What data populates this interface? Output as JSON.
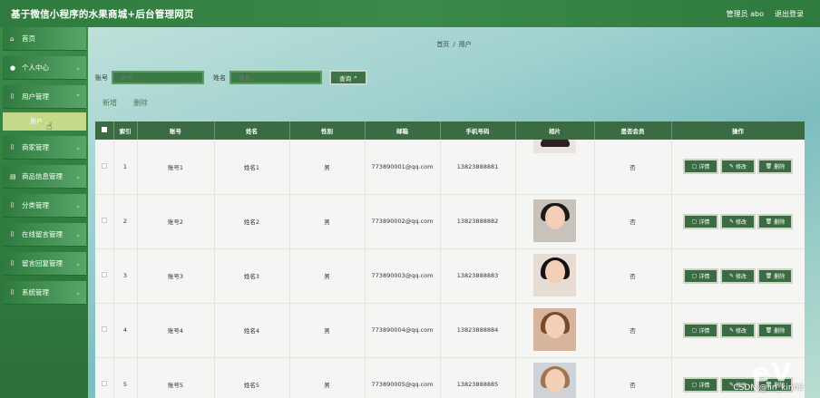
{
  "header": {
    "app_title": "基于微信小程序的水果商城+后台管理网页",
    "admin_label": "管理员 abo",
    "logout_label": "退出登录"
  },
  "sidebar": {
    "items": [
      {
        "label": "首页",
        "icon": "home-icon",
        "chevron": false
      },
      {
        "label": "个人中心",
        "icon": "user-icon",
        "chevron": true
      },
      {
        "label": "用户管理",
        "icon": "grid-icon",
        "chevron": true
      },
      {
        "label": "商家管理",
        "icon": "grid-icon",
        "chevron": true
      },
      {
        "label": "商品信息管理",
        "icon": "list-icon",
        "chevron": true
      },
      {
        "label": "分类管理",
        "icon": "grid-icon",
        "chevron": true
      },
      {
        "label": "在线留言管理",
        "icon": "grid-icon",
        "chevron": true
      },
      {
        "label": "留言回复管理",
        "icon": "grid-icon",
        "chevron": true
      },
      {
        "label": "系统管理",
        "icon": "grid-icon",
        "chevron": true
      }
    ],
    "active_sub": "用户"
  },
  "breadcrumb": {
    "home": "首页",
    "separator": "/",
    "current": "用户"
  },
  "search": {
    "account_label": "账号",
    "account_placeholder": "账号",
    "name_label": "姓名",
    "name_placeholder": "姓名",
    "query_label": "查询"
  },
  "actions": {
    "add_label": "新增",
    "delete_label": "删除"
  },
  "table": {
    "columns": [
      "索引",
      "账号",
      "姓名",
      "性别",
      "邮箱",
      "手机号码",
      "相片",
      "是否会员",
      "操作"
    ],
    "op_labels": {
      "detail": "详情",
      "edit": "修改",
      "delete": "删除"
    },
    "rows": [
      {
        "index": "1",
        "account": "账号1",
        "name": "姓名1",
        "gender": "男",
        "email": "773890001@qq.com",
        "phone": "13823888881",
        "member": "否"
      },
      {
        "index": "2",
        "account": "账号2",
        "name": "姓名2",
        "gender": "男",
        "email": "773890002@qq.com",
        "phone": "13823888882",
        "member": "否"
      },
      {
        "index": "3",
        "account": "账号3",
        "name": "姓名3",
        "gender": "男",
        "email": "773890003@qq.com",
        "phone": "13823888883",
        "member": "否"
      },
      {
        "index": "4",
        "account": "账号4",
        "name": "姓名4",
        "gender": "男",
        "email": "773890004@qq.com",
        "phone": "13823888884",
        "member": "否"
      },
      {
        "index": "5",
        "account": "账号5",
        "name": "姓名5",
        "gender": "男",
        "email": "773890005@qq.com",
        "phone": "13823888885",
        "member": "否"
      }
    ]
  },
  "watermark": "CSDN @lin_kin02",
  "brand_mark": "eV",
  "colors": {
    "header": "#2f7a3e",
    "table_header": "#3a6b42",
    "active_sub": "#c5d98a"
  }
}
